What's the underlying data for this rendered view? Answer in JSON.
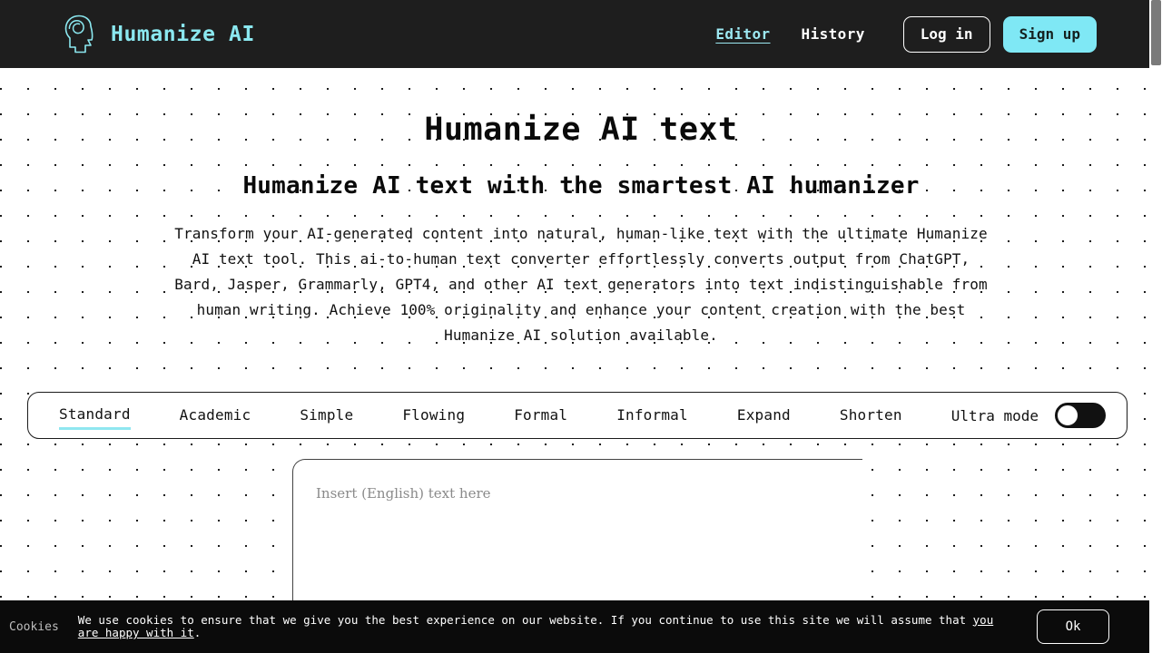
{
  "header": {
    "logo_icon": "head-spiral-logo-icon",
    "brand_name": "Humanize AI",
    "nav": [
      {
        "label": "Editor",
        "active": true
      },
      {
        "label": "History",
        "active": false
      }
    ],
    "login_label": "Log in",
    "signup_label": "Sign up",
    "background_color": "#1e1e1e",
    "accent_color": "#7fe8f5"
  },
  "hero": {
    "title": "Humanize AI text",
    "subtitle": "Humanize AI text with the smartest AI humanizer",
    "description": "Transform your AI-generated content into natural, human-like text with the ultimate Humanize AI text tool. This ai-to-human text converter effortlessly converts output from ChatGPT, Bard, Jasper, Grammarly, GPT4, and other AI text generators into text indistinguishable from human writing. Achieve 100% originality and enhance your content creation with the best Humanize AI solution available."
  },
  "mode_bar": {
    "tabs": [
      {
        "label": "Standard",
        "active": true
      },
      {
        "label": "Academic",
        "active": false
      },
      {
        "label": "Simple",
        "active": false
      },
      {
        "label": "Flowing",
        "active": false
      },
      {
        "label": "Formal",
        "active": false
      },
      {
        "label": "Informal",
        "active": false
      },
      {
        "label": "Expand",
        "active": false
      },
      {
        "label": "Shorten",
        "active": false
      }
    ],
    "ultra_mode_label": "Ultra mode",
    "ultra_mode_on": false,
    "active_underline_color": "#8fe7f0"
  },
  "editor": {
    "placeholder": "Insert (English) text here",
    "value": ""
  },
  "cookies": {
    "title": "Cookies",
    "message_part1": "We use cookies to ensure that we give you the best experience on our website. If you continue to use this site we will assume that ",
    "link_text": "you are happy with it",
    "message_part2": ".",
    "ok_label": "Ok"
  },
  "scrollbar": {
    "thumb_color": "#7a7a7a"
  }
}
